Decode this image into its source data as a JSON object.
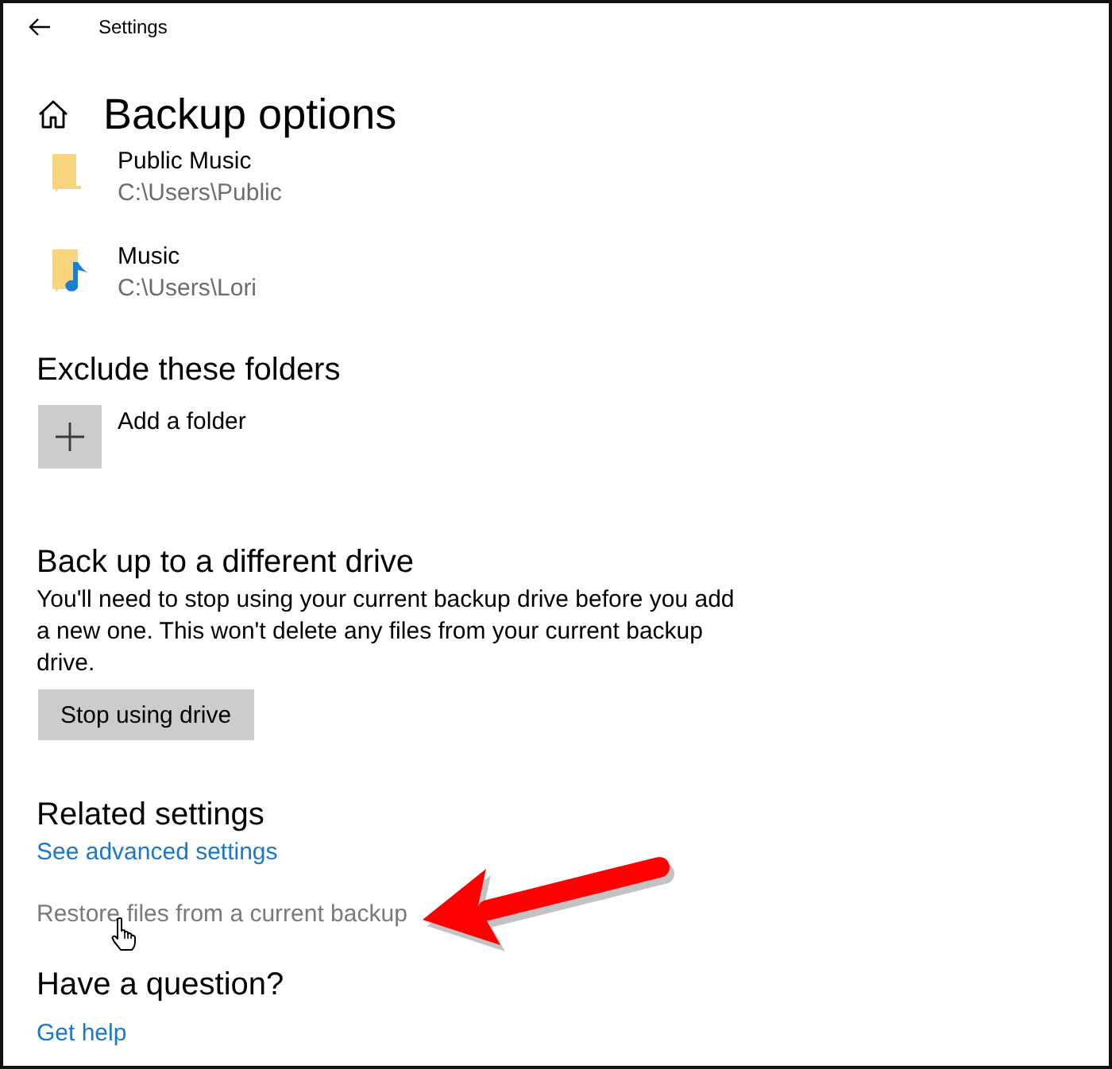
{
  "window": {
    "title": "Settings"
  },
  "page": {
    "title": "Backup options"
  },
  "folders": [
    {
      "name": "Public Music",
      "path": "C:\\Users\\Public",
      "kind": "plain"
    },
    {
      "name": "Music",
      "path": "C:\\Users\\Lori",
      "kind": "music"
    }
  ],
  "exclude": {
    "heading": "Exclude these folders",
    "add_label": "Add a folder"
  },
  "different_drive": {
    "heading": "Back up to a different drive",
    "text": "You'll need to stop using your current backup drive before you add a new one. This won't delete any files from your current backup drive.",
    "button": "Stop using drive"
  },
  "related": {
    "heading": "Related settings",
    "links": [
      {
        "label": "See advanced settings",
        "hovered": false
      },
      {
        "label": "Restore files from a current backup",
        "hovered": true
      }
    ]
  },
  "help": {
    "heading": "Have a question?",
    "links": [
      {
        "label": "Get help",
        "hovered": false
      }
    ]
  }
}
